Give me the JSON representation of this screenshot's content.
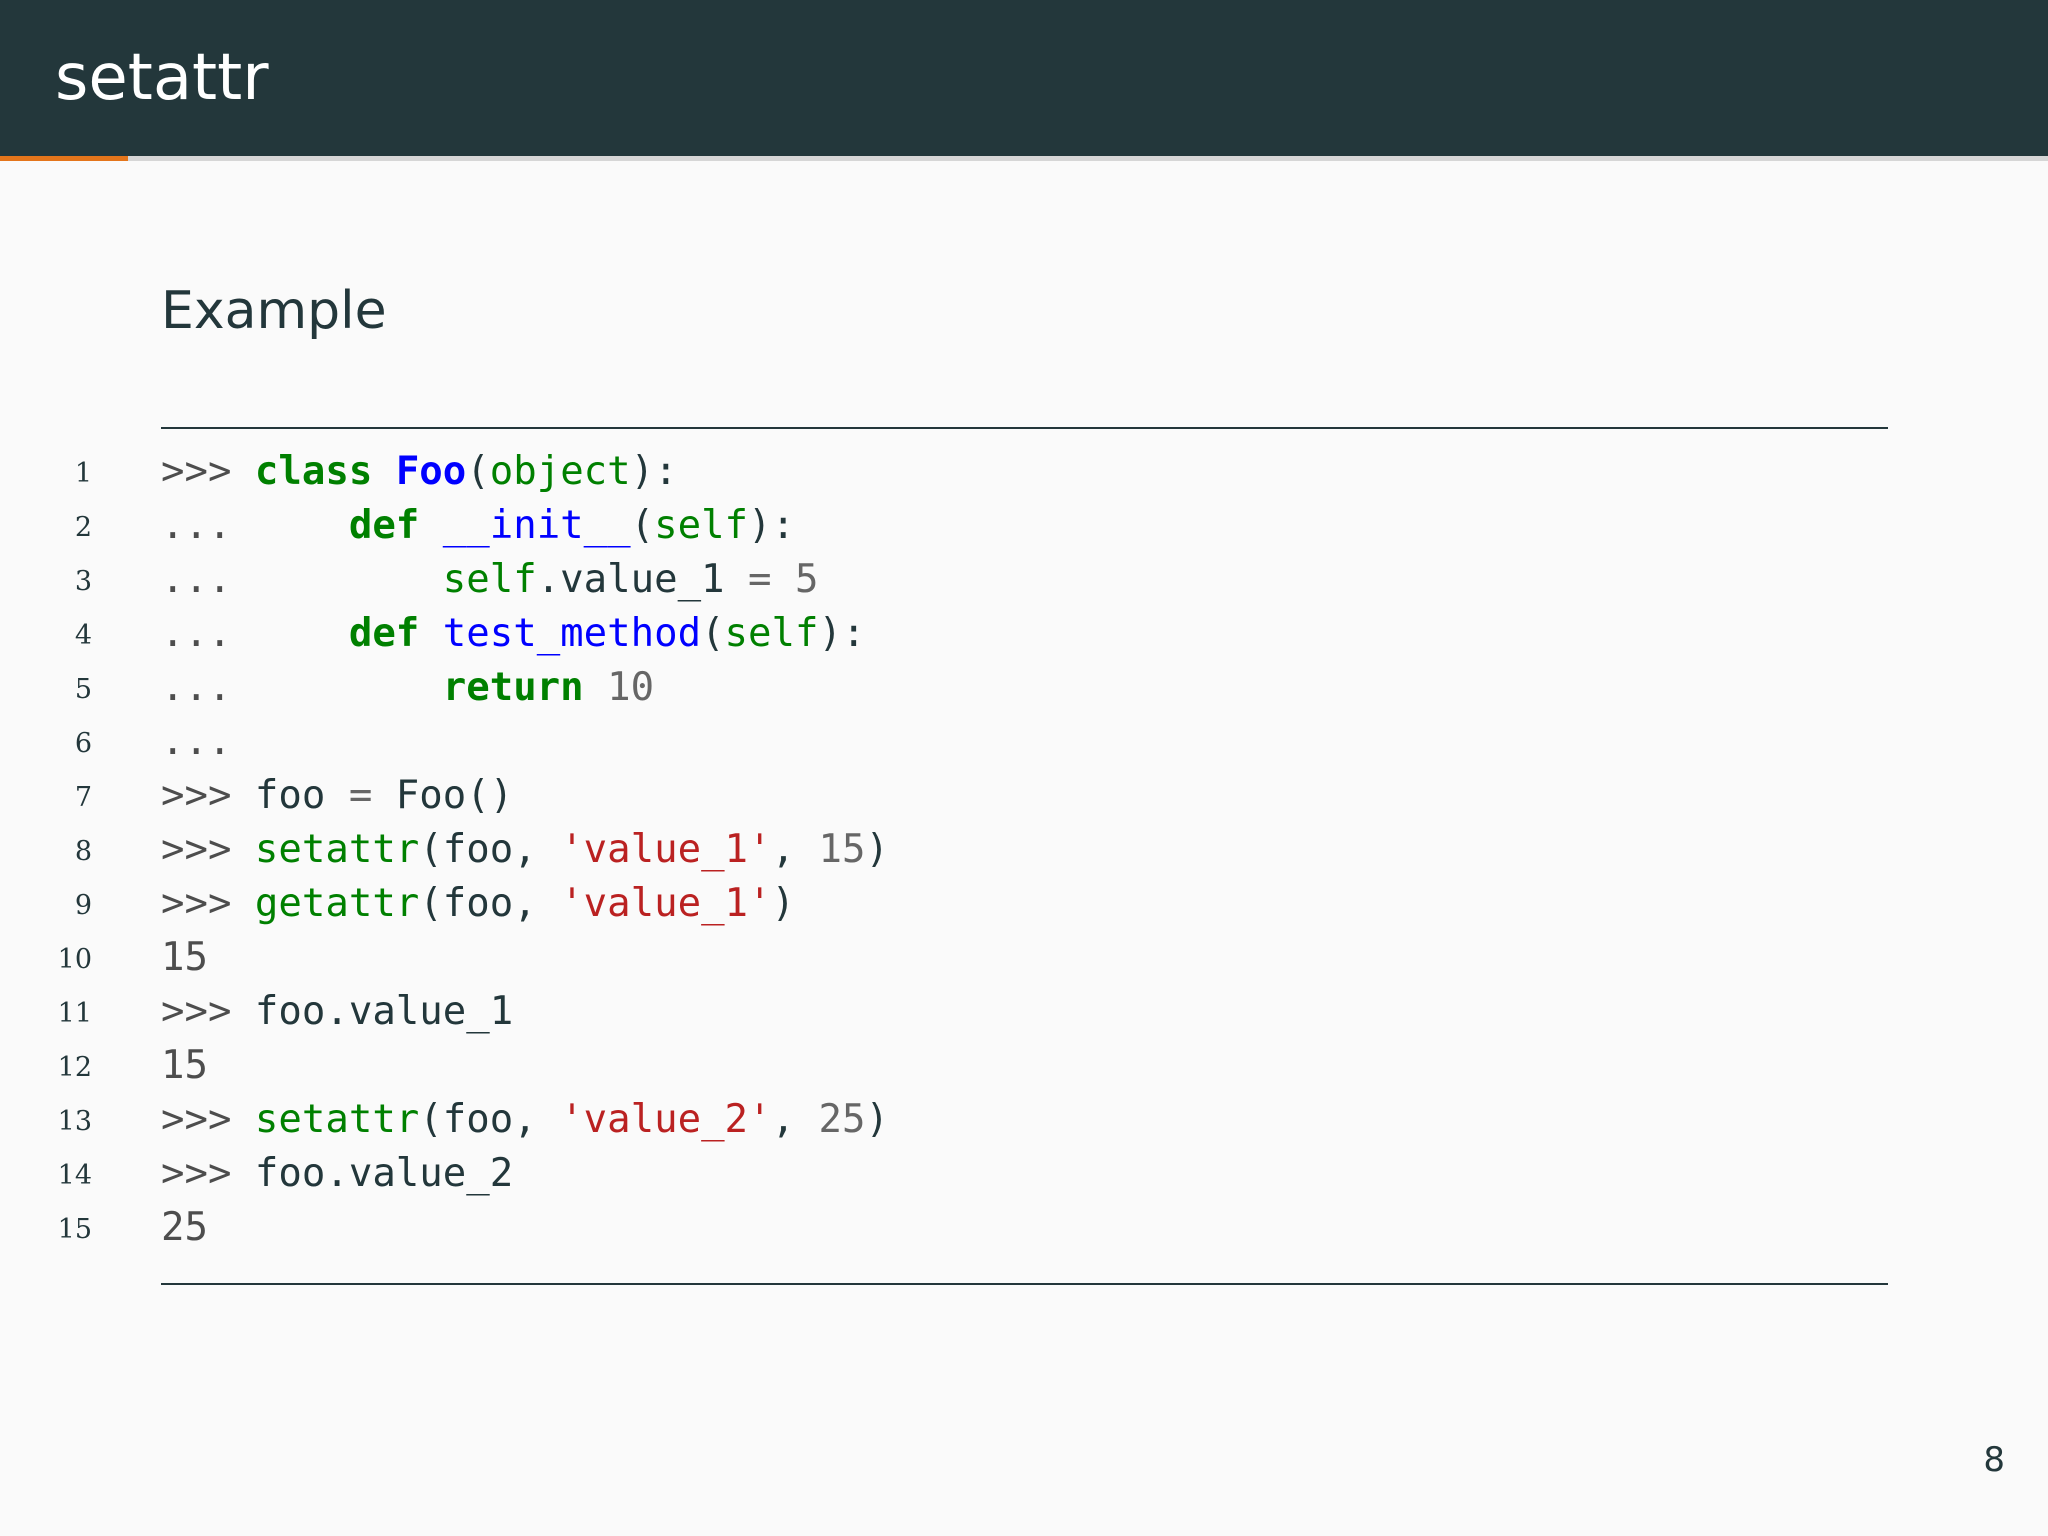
{
  "slide": {
    "title": "setattr",
    "progress_fraction": 0.0625,
    "page_number": "8"
  },
  "block": {
    "title": "Example"
  },
  "colors": {
    "header_background": "#23373b",
    "progress_accent": "#e4751b",
    "keyword": "#008000",
    "function_name": "#0000ff",
    "string": "#ba2121",
    "number": "#666666"
  },
  "code": {
    "lines": [
      {
        "number": "1",
        "tokens": [
          {
            "text": ">>> ",
            "type": "prompt"
          },
          {
            "text": "class",
            "type": "kw"
          },
          {
            "text": " ",
            "type": "name"
          },
          {
            "text": "Foo",
            "type": "class"
          },
          {
            "text": "(",
            "type": "name"
          },
          {
            "text": "object",
            "type": "builtin"
          },
          {
            "text": "):",
            "type": "name"
          }
        ]
      },
      {
        "number": "2",
        "tokens": [
          {
            "text": "...     ",
            "type": "prompt"
          },
          {
            "text": "def",
            "type": "kw"
          },
          {
            "text": " ",
            "type": "name"
          },
          {
            "text": "__init__",
            "type": "func"
          },
          {
            "text": "(",
            "type": "name"
          },
          {
            "text": "self",
            "type": "builtin"
          },
          {
            "text": "):",
            "type": "name"
          }
        ]
      },
      {
        "number": "3",
        "tokens": [
          {
            "text": "...         ",
            "type": "prompt"
          },
          {
            "text": "self",
            "type": "builtin"
          },
          {
            "text": ".value_1 ",
            "type": "name"
          },
          {
            "text": "=",
            "type": "op"
          },
          {
            "text": " ",
            "type": "name"
          },
          {
            "text": "5",
            "type": "num"
          }
        ]
      },
      {
        "number": "4",
        "tokens": [
          {
            "text": "...     ",
            "type": "prompt"
          },
          {
            "text": "def",
            "type": "kw"
          },
          {
            "text": " ",
            "type": "name"
          },
          {
            "text": "test_method",
            "type": "func"
          },
          {
            "text": "(",
            "type": "name"
          },
          {
            "text": "self",
            "type": "builtin"
          },
          {
            "text": "):",
            "type": "name"
          }
        ]
      },
      {
        "number": "5",
        "tokens": [
          {
            "text": "...         ",
            "type": "prompt"
          },
          {
            "text": "return",
            "type": "kw"
          },
          {
            "text": " ",
            "type": "name"
          },
          {
            "text": "10",
            "type": "num"
          }
        ]
      },
      {
        "number": "6",
        "tokens": [
          {
            "text": "...",
            "type": "prompt"
          }
        ]
      },
      {
        "number": "7",
        "tokens": [
          {
            "text": ">>> ",
            "type": "prompt"
          },
          {
            "text": "foo ",
            "type": "name"
          },
          {
            "text": "=",
            "type": "op"
          },
          {
            "text": " Foo()",
            "type": "name"
          }
        ]
      },
      {
        "number": "8",
        "tokens": [
          {
            "text": ">>> ",
            "type": "prompt"
          },
          {
            "text": "setattr",
            "type": "builtin"
          },
          {
            "text": "(foo, ",
            "type": "name"
          },
          {
            "text": "'value_1'",
            "type": "str"
          },
          {
            "text": ", ",
            "type": "name"
          },
          {
            "text": "15",
            "type": "num"
          },
          {
            "text": ")",
            "type": "name"
          }
        ]
      },
      {
        "number": "9",
        "tokens": [
          {
            "text": ">>> ",
            "type": "prompt"
          },
          {
            "text": "getattr",
            "type": "builtin"
          },
          {
            "text": "(foo, ",
            "type": "name"
          },
          {
            "text": "'value_1'",
            "type": "str"
          },
          {
            "text": ")",
            "type": "name"
          }
        ]
      },
      {
        "number": "10",
        "tokens": [
          {
            "text": "15",
            "type": "out"
          }
        ]
      },
      {
        "number": "11",
        "tokens": [
          {
            "text": ">>> ",
            "type": "prompt"
          },
          {
            "text": "foo.value_1",
            "type": "name"
          }
        ]
      },
      {
        "number": "12",
        "tokens": [
          {
            "text": "15",
            "type": "out"
          }
        ]
      },
      {
        "number": "13",
        "tokens": [
          {
            "text": ">>> ",
            "type": "prompt"
          },
          {
            "text": "setattr",
            "type": "builtin"
          },
          {
            "text": "(foo, ",
            "type": "name"
          },
          {
            "text": "'value_2'",
            "type": "str"
          },
          {
            "text": ", ",
            "type": "name"
          },
          {
            "text": "25",
            "type": "num"
          },
          {
            "text": ")",
            "type": "name"
          }
        ]
      },
      {
        "number": "14",
        "tokens": [
          {
            "text": ">>> ",
            "type": "prompt"
          },
          {
            "text": "foo.value_2",
            "type": "name"
          }
        ]
      },
      {
        "number": "15",
        "tokens": [
          {
            "text": "25",
            "type": "out"
          }
        ]
      }
    ]
  }
}
